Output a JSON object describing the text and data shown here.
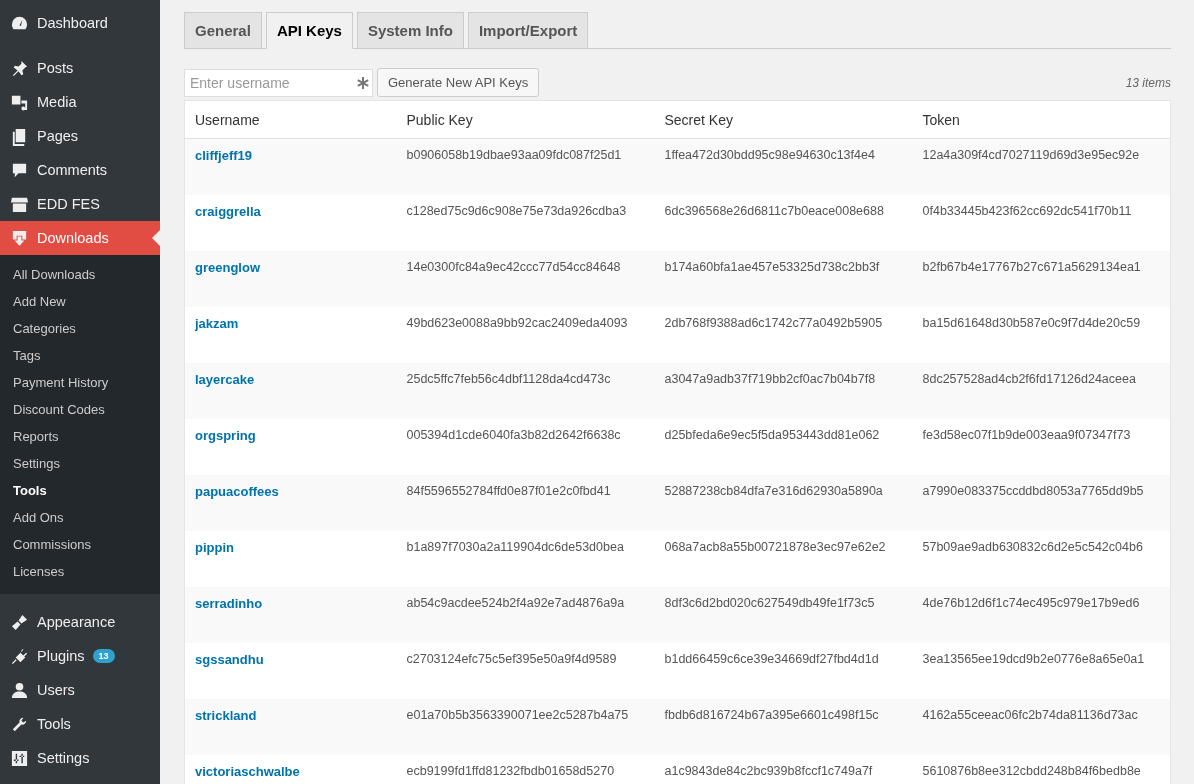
{
  "sidebar": {
    "groups": [
      [
        {
          "label": "Dashboard",
          "selected": false
        }
      ],
      [
        {
          "label": "Posts",
          "selected": false
        },
        {
          "label": "Media",
          "selected": false
        },
        {
          "label": "Pages",
          "selected": false
        },
        {
          "label": "Comments",
          "selected": false
        },
        {
          "label": "EDD FES",
          "selected": false
        },
        {
          "label": "Downloads",
          "selected": true,
          "children": [
            {
              "label": "All Downloads",
              "selected": false
            },
            {
              "label": "Add New",
              "selected": false
            },
            {
              "label": "Categories",
              "selected": false
            },
            {
              "label": "Tags",
              "selected": false
            },
            {
              "label": "Payment History",
              "selected": false
            },
            {
              "label": "Discount Codes",
              "selected": false
            },
            {
              "label": "Reports",
              "selected": false
            },
            {
              "label": "Settings",
              "selected": false
            },
            {
              "label": "Tools",
              "selected": true
            },
            {
              "label": "Add Ons",
              "selected": false
            },
            {
              "label": "Commissions",
              "selected": false
            },
            {
              "label": "Licenses",
              "selected": false
            }
          ]
        }
      ],
      [
        {
          "label": "Appearance",
          "selected": false
        },
        {
          "label": "Plugins",
          "selected": false,
          "badge": "13"
        },
        {
          "label": "Users",
          "selected": false
        },
        {
          "label": "Tools",
          "selected": false
        },
        {
          "label": "Settings",
          "selected": false
        }
      ]
    ]
  },
  "tabs": [
    {
      "label": "General",
      "selected": false
    },
    {
      "label": "API Keys",
      "selected": true
    },
    {
      "label": "System Info",
      "selected": false
    },
    {
      "label": "Import/Export",
      "selected": false
    }
  ],
  "search": {
    "placeholder": "Enter username"
  },
  "generate_button": "Generate New API Keys",
  "item_count": "13 items",
  "table": {
    "columns": [
      "Username",
      "Public Key",
      "Secret Key",
      "Token"
    ],
    "rows": [
      [
        "cliffjeff19",
        "b0906058b19dbae93aa09fdc087f25d1",
        "1ffea472d30bdd95c98e94630c13f4e4",
        "12a4a309f4cd7027119d69d3e95ec92e"
      ],
      [
        "craiggrella",
        "c128ed75c9d6c908e75e73da926cdba3",
        "6dc396568e26d6811c7b0eace008e688",
        "0f4b33445b423f62cc692dc541f70b11"
      ],
      [
        "greenglow",
        "14e0300fc84a9ec42ccc77d54cc84648",
        "b174a60bfa1ae457e53325d738c2bb3f",
        "b2fb67b4e17767b27c671a5629134ea1"
      ],
      [
        "jakzam",
        "49bd623e0088a9bb92cac2409eda4093",
        "2db768f9388ad6c1742c77a0492b5905",
        "ba15d61648d30b587e0c9f7d4de20c59"
      ],
      [
        "layercake",
        "25dc5ffc7feb56c4dbf1128da4cd473c",
        "a3047a9adb37f719bb2cf0ac7b04b7f8",
        "8dc257528ad4cb2f6fd17126d24aceea"
      ],
      [
        "orgspring",
        "005394d1cde6040fa3b82d2642f6638c",
        "d25bfeda6e9ec5f5da953443dd81e062",
        "fe3d58ec07f1b9de003eaa9f07347f73"
      ],
      [
        "papuacoffees",
        "84f5596552784ffd0e87f01e2c0fbd41",
        "52887238cb84dfa7e316d62930a5890a",
        "a7990e083375ccddbd8053a7765dd9b5"
      ],
      [
        "pippin",
        "b1a897f7030a2a119904dc6de53d0bea",
        "068a7acb8a55b00721878e3ec97e62e2",
        "57b09ae9adb630832c6d2e5c542c04b6"
      ],
      [
        "serradinho",
        "ab54c9acdee524b2f4a92e7ad4876a9a",
        "8df3c6d2bd020c627549db49fe1f73c5",
        "4de76b12d6f1c74ec495c979e17b9ed6"
      ],
      [
        "sgssandhu",
        "c2703124efc75c5ef395e50a9f4d9589",
        "b1dd66459c6ce39e34669df27fbd4d1d",
        "3ea13565ee19dcd9b2e0776e8a65e0a1"
      ],
      [
        "strickland",
        "e01a70b5b3563390071ee2c5287b4a75",
        "fbdb6d816724b67a395e6601c498f15c",
        "4162a55ceeac06fc2b74da81136d73ac"
      ],
      [
        "victoriaschwalbe",
        "ecb9199fd1ffd81232fbdb01658d5270",
        "a1c9843de84c2bc939b8fccf1c749a7f",
        "5610876b8ee312cbdd248b84f6bedb8e"
      ]
    ]
  }
}
